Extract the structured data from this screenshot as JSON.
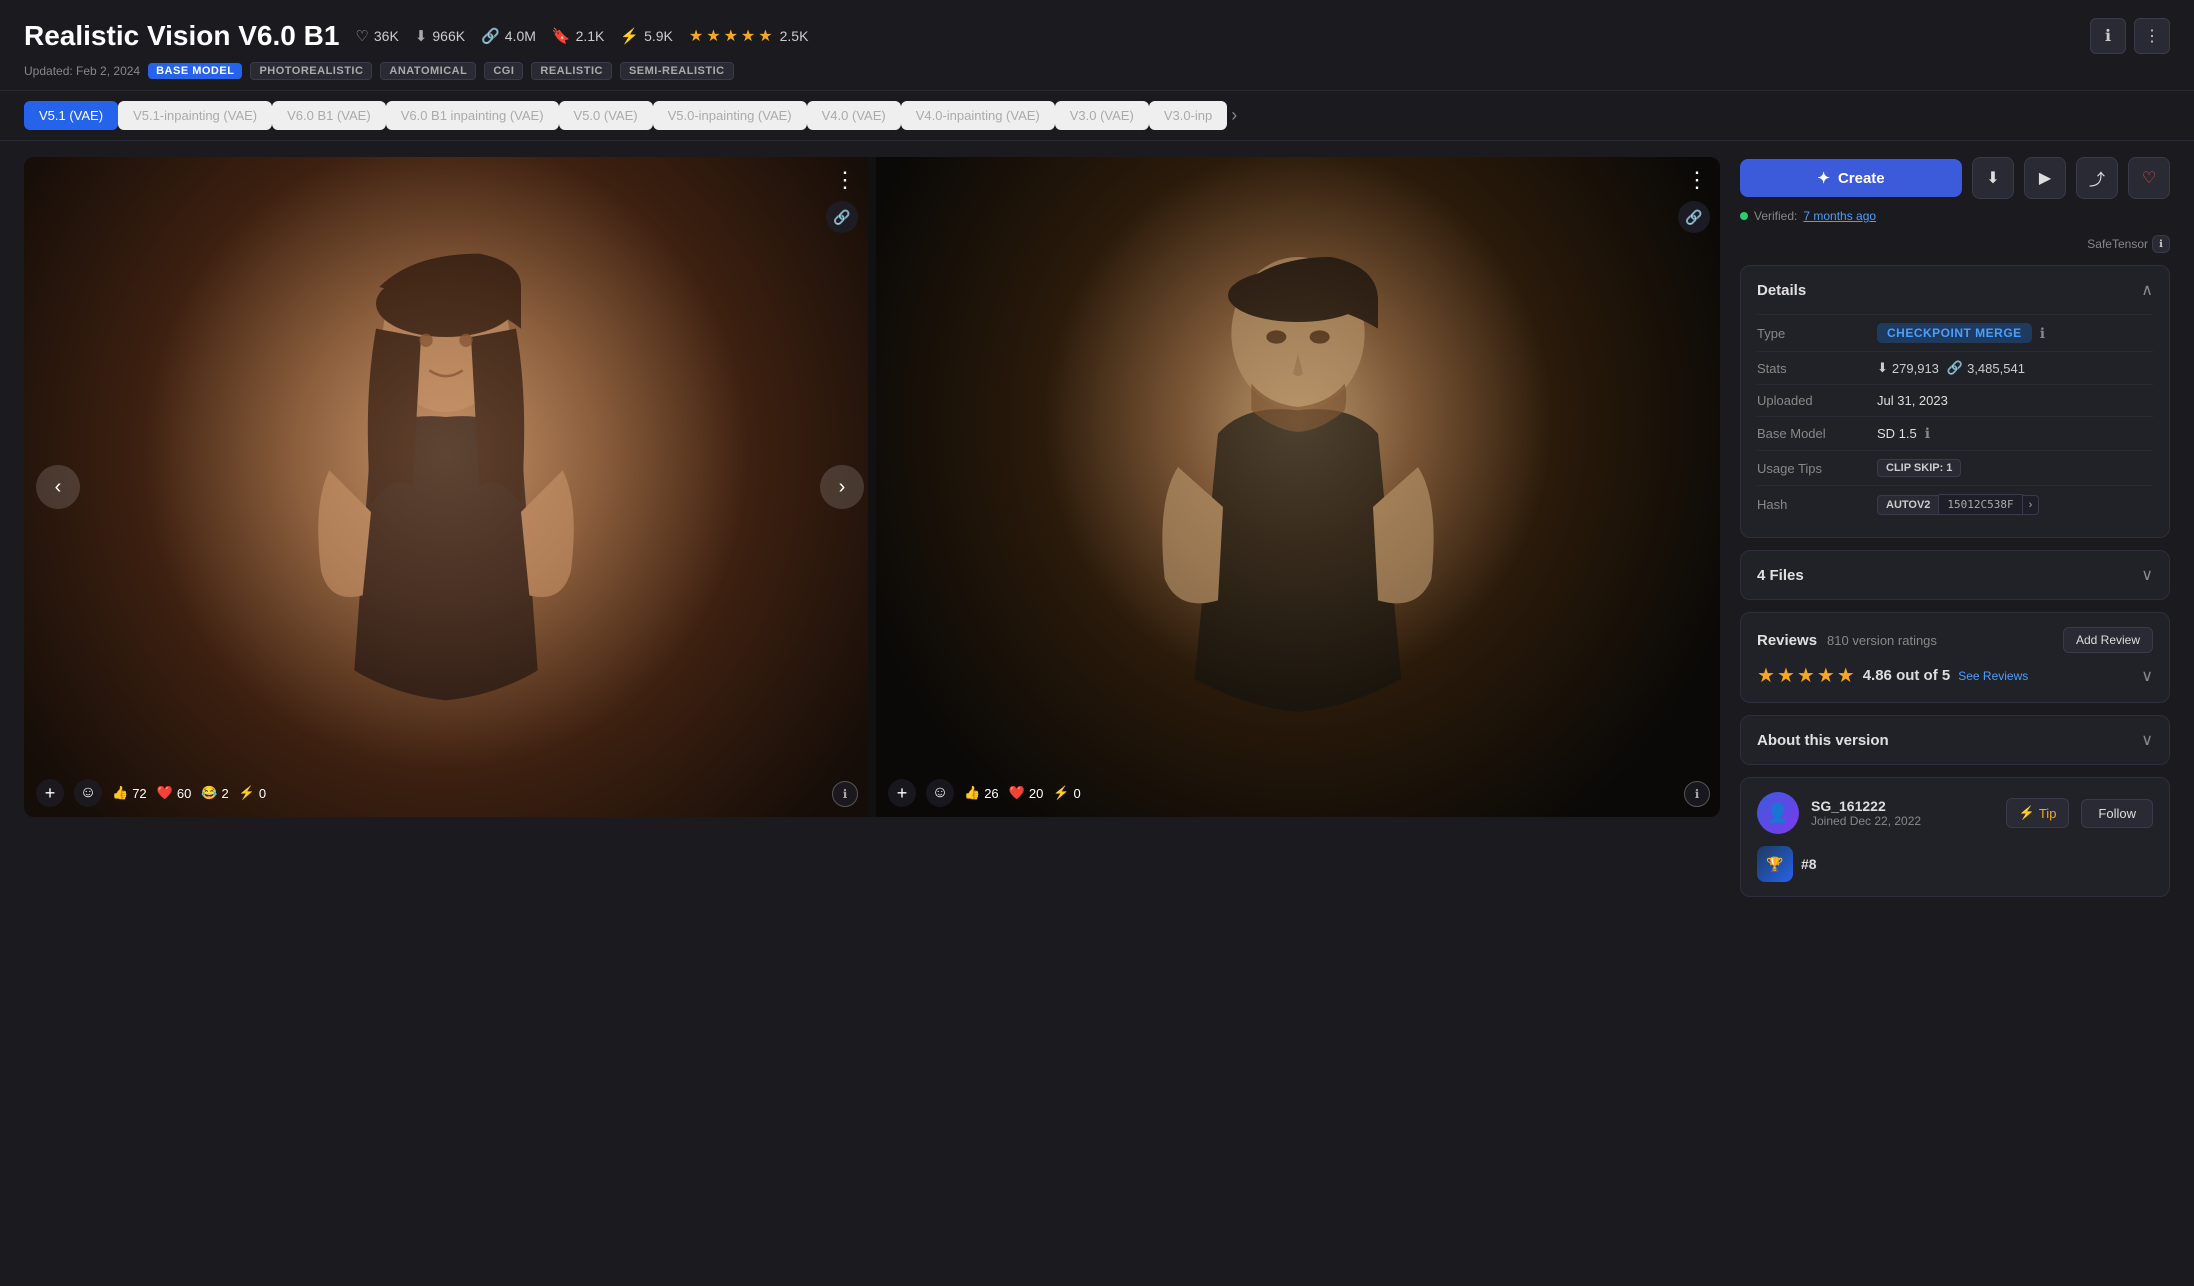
{
  "header": {
    "title": "Realistic Vision V6.0 B1",
    "updated": "Updated: Feb 2, 2024",
    "stats": {
      "likes": "36K",
      "downloads": "966K",
      "links": "4.0M",
      "bookmarks": "2.1K",
      "lightning": "5.9K",
      "rating": "2.5K"
    },
    "tags": [
      "BASE MODEL",
      "PHOTOREALISTIC",
      "ANATOMICAL",
      "CGI",
      "REALISTIC",
      "SEMI-REALISTIC"
    ]
  },
  "version_tabs": [
    {
      "label": "V5.1 (VAE)",
      "active": true
    },
    {
      "label": "V5.1-inpainting (VAE)",
      "active": false
    },
    {
      "label": "V6.0 B1 (VAE)",
      "active": false
    },
    {
      "label": "V6.0 B1 inpainting (VAE)",
      "active": false
    },
    {
      "label": "V5.0 (VAE)",
      "active": false
    },
    {
      "label": "V5.0-inpainting (VAE)",
      "active": false
    },
    {
      "label": "V4.0 (VAE)",
      "active": false
    },
    {
      "label": "V4.0-inpainting (VAE)",
      "active": false
    },
    {
      "label": "V3.0 (VAE)",
      "active": false
    },
    {
      "label": "V3.0-inp",
      "active": false
    }
  ],
  "gallery": {
    "image1": {
      "likes": "72",
      "hearts": "60",
      "laughs": "2",
      "lightning": "0"
    },
    "image2": {
      "likes": "26",
      "hearts": "20",
      "lightning": "0"
    }
  },
  "sidebar": {
    "create_label": "Create",
    "safetensor_label": "SafeTensor",
    "verified_label": "Verified:",
    "verified_time": "7 months ago",
    "details": {
      "title": "Details",
      "type_label": "Type",
      "type_value": "CHECKPOINT MERGE",
      "stats_label": "Stats",
      "downloads_val": "279,913",
      "links_val": "3,485,541",
      "uploaded_label": "Uploaded",
      "uploaded_val": "Jul 31, 2023",
      "base_model_label": "Base Model",
      "base_model_val": "SD 1.5",
      "usage_tips_label": "Usage Tips",
      "clip_skip_val": "CLIP SKIP: 1",
      "hash_label": "Hash",
      "hash_algo": "AUTOV2",
      "hash_val": "15012C538F"
    },
    "files": {
      "title": "4 Files"
    },
    "reviews": {
      "title": "Reviews",
      "count": "810",
      "version_ratings": "version ratings",
      "add_review": "Add Review",
      "rating": "4.86",
      "out_of": "out of 5",
      "see_reviews": "See Reviews"
    },
    "about": {
      "title": "About this version"
    },
    "author": {
      "name": "SG_161222",
      "joined": "Joined Dec 22, 2022",
      "rank": "#8",
      "tip_label": "Tip",
      "follow_label": "Follow"
    }
  }
}
